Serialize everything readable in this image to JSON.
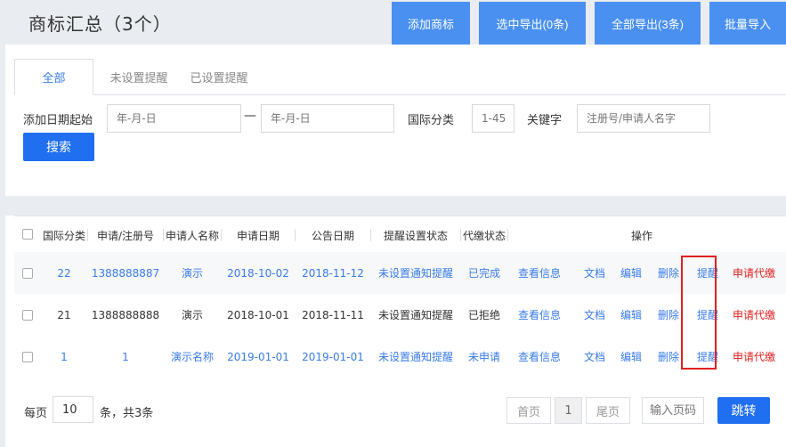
{
  "header": {
    "title": "商标汇总（3个）",
    "buttons": [
      "添加商标",
      "选中导出(0条)",
      "全部导出(3条)",
      "批量导入"
    ]
  },
  "tabs": [
    "全部",
    "未设置提醒",
    "已设置提醒"
  ],
  "filters": {
    "date_label": "添加日期起始",
    "date_start_placeholder": "年-月-日",
    "date_sep": "—",
    "date_end_placeholder": "年-月-日",
    "class_label": "国际分类",
    "class_placeholder": "1-45",
    "keyword_label": "关键字",
    "keyword_placeholder": "注册号/申请人名字",
    "search_button": "搜索"
  },
  "table": {
    "headers": [
      "国际分类",
      "申请/注册号",
      "申请人名称",
      "申请日期",
      "公告日期",
      "提醒设置状态",
      "代缴状态",
      "操作"
    ],
    "rows": [
      {
        "class": "22",
        "reg_no": "1388888887",
        "applicant": "演示",
        "apply_date": "2018-10-02",
        "notice_date": "2018-11-12",
        "remind_status": "未设置通知提醒",
        "pay_status": "已完成",
        "actions": [
          "查看信息",
          "文档",
          "编辑",
          "删除",
          "提醒",
          "申请代缴"
        ]
      },
      {
        "class": "21",
        "reg_no": "1388888888",
        "applicant": "演示",
        "apply_date": "2018-10-01",
        "notice_date": "2018-11-11",
        "remind_status": "未设置通知提醒",
        "pay_status": "已拒绝",
        "actions": [
          "查看信息",
          "文档",
          "编辑",
          "删除",
          "提醒",
          "申请代缴"
        ]
      },
      {
        "class": "1",
        "reg_no": "1",
        "applicant": "演示名称",
        "apply_date": "2019-01-01",
        "notice_date": "2019-01-01",
        "remind_status": "未设置通知提醒",
        "pay_status": "未申请",
        "actions": [
          "查看信息",
          "文档",
          "编辑",
          "删除",
          "提醒",
          "申请代缴"
        ]
      }
    ]
  },
  "pagination": {
    "per_page_label": "每页",
    "per_page_value": "10",
    "total_label": "条，共3条",
    "first": "首页",
    "current": "1",
    "last": "尾页",
    "page_input_placeholder": "输入页码",
    "jump_button": "跳转"
  },
  "colors": {
    "accent": "#1f6ff0",
    "header_button": "#4a90f0",
    "link": "#3a7be8",
    "danger": "#e02020"
  }
}
